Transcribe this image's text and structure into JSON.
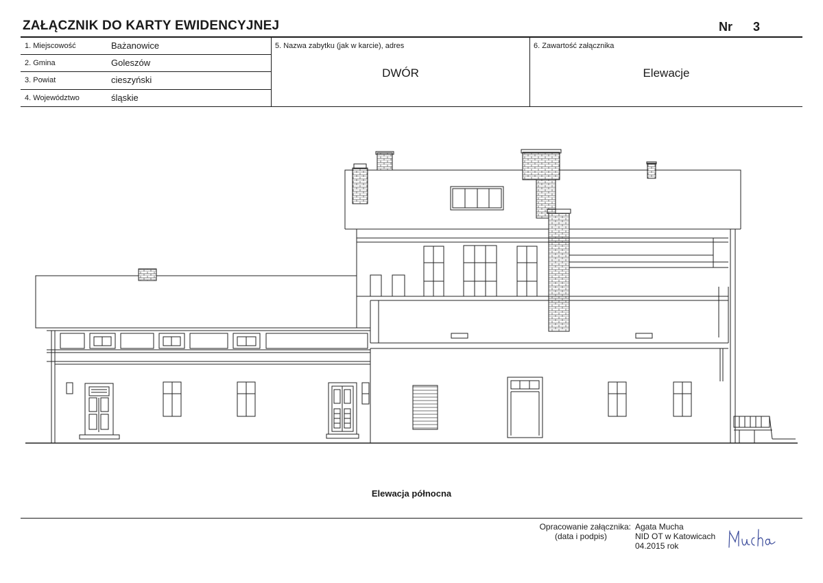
{
  "header": {
    "title": "ZAŁĄCZNIK DO KARTY EWIDENCYJNEJ",
    "nr_label": "Nr",
    "nr_value": "3"
  },
  "fields": [
    {
      "label": "1. Miejscowość",
      "value": "Bażanowice"
    },
    {
      "label": "2. Gmina",
      "value": "Goleszów"
    },
    {
      "label": "3. Powiat",
      "value": "cieszyński"
    },
    {
      "label": "4. Województwo",
      "value": "śląskie"
    }
  ],
  "monument": {
    "label": "5. Nazwa zabytku (jak w karcie), adres",
    "value": "DWÓR"
  },
  "content": {
    "label": "6. Zawartość załącznika",
    "value": "Elewacje"
  },
  "drawing": {
    "caption": "Elewacja północna"
  },
  "footer": {
    "prepared_label": "Opracowanie załącznika:",
    "prepared_sublabel": "(data i podpis)",
    "author": "Agata Mucha",
    "institution": "NID OT w Katowicach",
    "date": "04.2015 rok",
    "signature": "Mucha"
  }
}
